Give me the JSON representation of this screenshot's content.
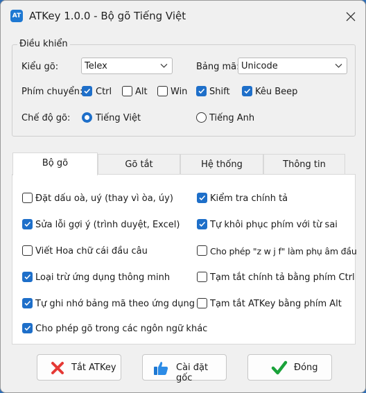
{
  "window": {
    "app_icon_text": "AT",
    "title": "ATKey 1.0.0 - Bộ gõ Tiếng Việt"
  },
  "controls": {
    "group_label": "Điều khiển",
    "input_method": {
      "label": "Kiểu gõ:",
      "value": "Telex"
    },
    "charset": {
      "label": "Bảng mã:",
      "value": "Unicode"
    },
    "hotkey": {
      "label": "Phím chuyển:",
      "options": [
        {
          "label": "Ctrl",
          "checked": true
        },
        {
          "label": "Alt",
          "checked": false
        },
        {
          "label": "Win",
          "checked": false
        },
        {
          "label": "Shift",
          "checked": true
        },
        {
          "label": "Kêu Beep",
          "checked": true
        }
      ]
    },
    "mode": {
      "label": "Chế độ gõ:",
      "options": [
        {
          "label": "Tiếng Việt",
          "selected": true
        },
        {
          "label": "Tiếng Anh",
          "selected": false
        }
      ]
    }
  },
  "tabs": [
    {
      "label": "Bộ gõ",
      "active": true
    },
    {
      "label": "Gõ tắt",
      "active": false
    },
    {
      "label": "Hệ thống",
      "active": false
    },
    {
      "label": "Thông tin",
      "active": false
    }
  ],
  "options_left": [
    {
      "label": "Đặt dấu oà, uý (thay vì òa, úy)",
      "checked": false
    },
    {
      "label": "Sửa lỗi gợi ý (trình duyệt, Excel)",
      "checked": true
    },
    {
      "label": "Viết Hoa chữ cái đầu câu",
      "checked": false
    },
    {
      "label": "Loại trừ ứng dụng thông minh",
      "checked": true
    },
    {
      "label": "Tự ghi nhớ bảng mã theo ứng dụng",
      "checked": true
    },
    {
      "label": "Cho phép gõ trong các ngôn ngữ khác",
      "checked": true
    }
  ],
  "options_right": [
    {
      "label": "Kiểm tra chính tả",
      "checked": true
    },
    {
      "label": "Tự khôi phục phím với từ sai",
      "checked": true
    },
    {
      "label": "Cho phép \"z w j f\" làm phụ âm đầu",
      "checked": false
    },
    {
      "label": "Tạm tắt chính tả bằng phím Ctrl",
      "checked": false
    },
    {
      "label": "Tạm tắt ATKey bằng phím Alt",
      "checked": false
    }
  ],
  "buttons": {
    "disable": {
      "label": "Tắt ATKey",
      "icon": "red-x-icon"
    },
    "defaults": {
      "label": "Cài đặt gốc",
      "icon": "thumbs-up-icon"
    },
    "close": {
      "label": "Đóng",
      "icon": "green-check-icon"
    }
  },
  "colors": {
    "checkbox_accent": "#1e6fc9",
    "disable_icon": "#e53935",
    "defaults_icon": "#1e78d2",
    "close_icon": "#1aa23a"
  }
}
